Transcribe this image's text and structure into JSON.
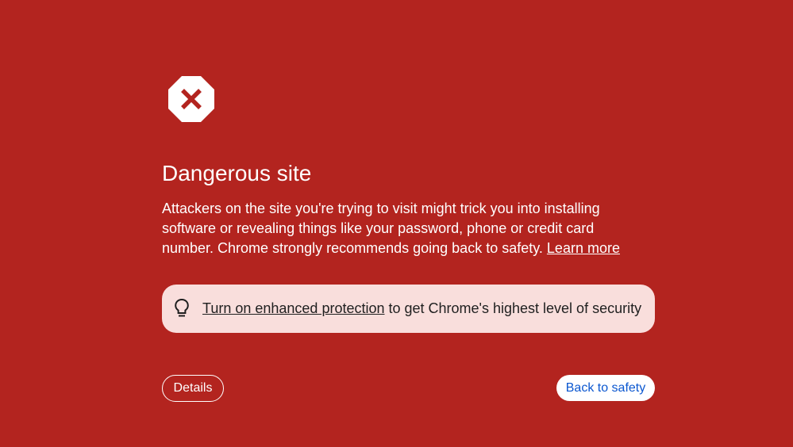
{
  "page": {
    "background_color": "#b3241f"
  },
  "icons": {
    "stop": "stop-sign-x-icon",
    "tip": "lightbulb-icon"
  },
  "interstitial": {
    "title": "Dangerous site",
    "body": "Attackers on the site you're trying to visit might trick you into installing software or revealing things like your password, phone or credit card number. Chrome strongly recommends going back to safety.",
    "learn_more": "Learn more"
  },
  "tip": {
    "link_text": "Turn on enhanced protection",
    "rest_text": " to get Chrome's highest level of security",
    "background_color": "#f9dedc"
  },
  "buttons": {
    "details": "Details",
    "back": "Back to safety",
    "back_text_color": "#0b57d0"
  }
}
